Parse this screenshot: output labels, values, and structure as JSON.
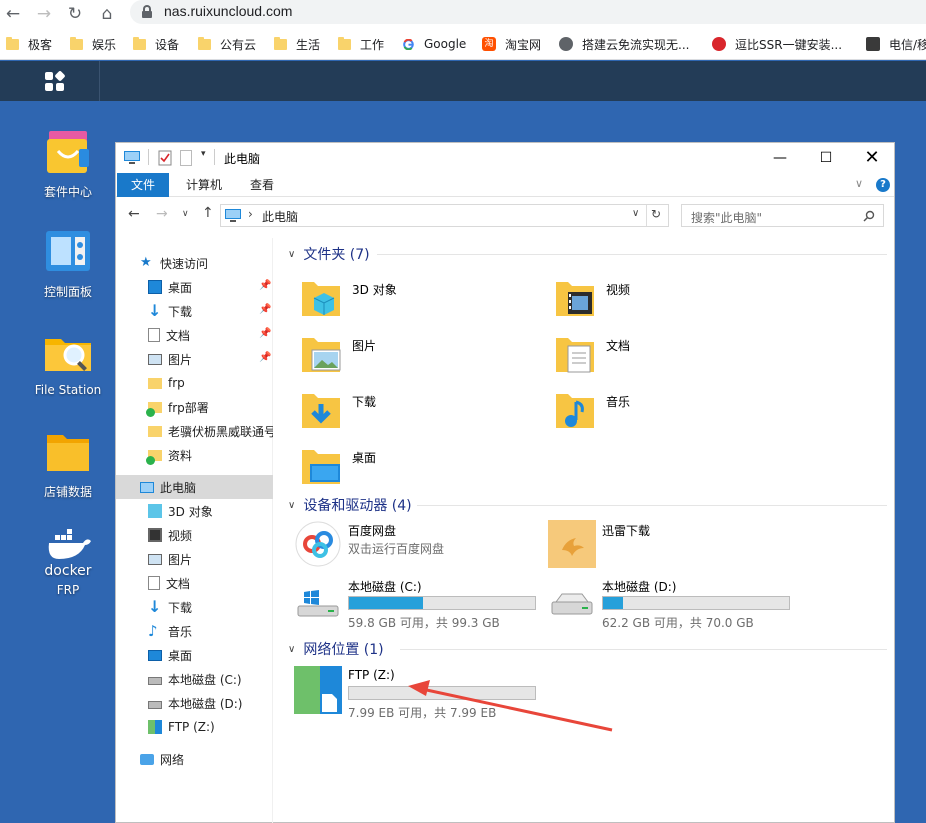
{
  "browser": {
    "url": "nas.ruixuncloud.com",
    "bookmarks": [
      {
        "label": "极客",
        "icon": "folder-icon"
      },
      {
        "label": "娱乐",
        "icon": "folder-icon"
      },
      {
        "label": "设备",
        "icon": "folder-icon"
      },
      {
        "label": "公有云",
        "icon": "folder-icon"
      },
      {
        "label": "生活",
        "icon": "folder-icon"
      },
      {
        "label": "工作",
        "icon": "folder-icon"
      },
      {
        "label": "Google",
        "icon": "google-icon"
      },
      {
        "label": "淘宝网",
        "icon": "taobao-icon"
      },
      {
        "label": "搭建云免流实现无...",
        "icon": "globe-icon"
      },
      {
        "label": "逗比SSR一键安装...",
        "icon": "red-icon"
      },
      {
        "label": "电信/移",
        "icon": "avatar-icon"
      }
    ]
  },
  "desktop": {
    "icons": [
      {
        "label": "套件中心"
      },
      {
        "label": "控制面板"
      },
      {
        "label": "File Station"
      },
      {
        "label": "店铺数据"
      },
      {
        "label": "FRP",
        "sublabel": "docker"
      }
    ]
  },
  "explorer": {
    "title": "此电脑",
    "ribbon_tabs": [
      "文件",
      "计算机",
      "查看"
    ],
    "breadcrumb": "此电脑",
    "search_placeholder": "搜索\"此电脑\"",
    "nav": {
      "quick_access": "快速访问",
      "quick_items": [
        {
          "label": "桌面",
          "pinned": true
        },
        {
          "label": "下载",
          "pinned": true
        },
        {
          "label": "文档",
          "pinned": true
        },
        {
          "label": "图片",
          "pinned": true
        },
        {
          "label": "frp",
          "pinned": false
        },
        {
          "label": "frp部署",
          "pinned": false
        },
        {
          "label": "老骥伏枥黑威联通号",
          "pinned": false
        },
        {
          "label": "资料",
          "pinned": false
        }
      ],
      "this_pc": "此电脑",
      "pc_items": [
        "3D 对象",
        "视频",
        "图片",
        "文档",
        "下载",
        "音乐",
        "桌面",
        "本地磁盘 (C:)",
        "本地磁盘 (D:)",
        "FTP (Z:)"
      ],
      "network": "网络"
    },
    "groups": {
      "folders": "文件夹 (7)",
      "devices": "设备和驱动器 (4)",
      "network": "网络位置 (1)"
    },
    "folders": [
      "3D 对象",
      "视频",
      "图片",
      "文档",
      "下载",
      "音乐",
      "桌面"
    ],
    "devices": [
      {
        "name": "百度网盘",
        "sub": "双击运行百度网盘"
      },
      {
        "name": "迅雷下载",
        "sub": ""
      },
      {
        "name": "本地磁盘 (C:)",
        "sub": "59.8 GB 可用，共 99.3 GB",
        "used_fraction": 0.4
      },
      {
        "name": "本地磁盘 (D:)",
        "sub": "62.2 GB 可用，共 70.0 GB",
        "used_fraction": 0.11
      }
    ],
    "network_locations": [
      {
        "name": "FTP (Z:)",
        "sub": "7.99 EB 可用，共 7.99 EB",
        "used_fraction": 0.0
      }
    ]
  },
  "colors": {
    "accent": "#1979ca",
    "desktop": "#2f66b1",
    "nas_bar": "#233c57",
    "arrow": "#e8463a"
  }
}
